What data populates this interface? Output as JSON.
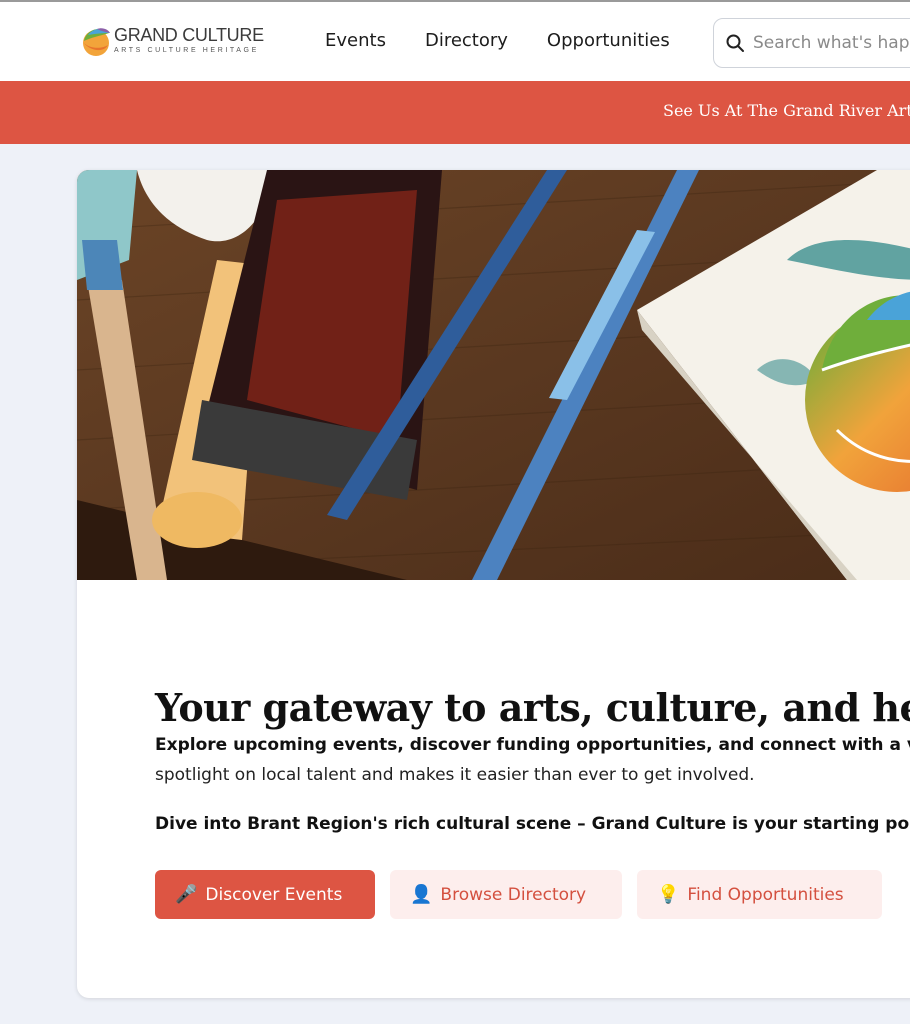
{
  "header": {
    "logo_title": "GRAND CULTURE",
    "logo_subtitle": "ARTS CULTURE HERITAGE",
    "nav": [
      {
        "label": "Events"
      },
      {
        "label": "Directory"
      },
      {
        "label": "Opportunities"
      }
    ],
    "search": {
      "placeholder": "Search what's happening",
      "icon": "search-icon"
    }
  },
  "banner": {
    "text": "See Us At The Grand River Arts"
  },
  "hero": {
    "headline": "Your gateway to arts, culture, and heritage",
    "intro_bold": "Explore upcoming events, discover funding opportunities, and connect with a vibrant",
    "intro_light": "spotlight on local talent and makes it easier than ever to get involved.",
    "dive": "Dive into Brant Region's rich cultural scene – Grand Culture is your starting point!",
    "buttons": [
      {
        "icon": "🎤",
        "label": "Discover Events"
      },
      {
        "icon": "👤",
        "label": "Browse Directory"
      },
      {
        "icon": "💡",
        "label": "Find Opportunities"
      }
    ]
  },
  "colors": {
    "accent": "#dd5543",
    "soft_button": "#fdeeed",
    "page_bg": "#eef1f8"
  }
}
